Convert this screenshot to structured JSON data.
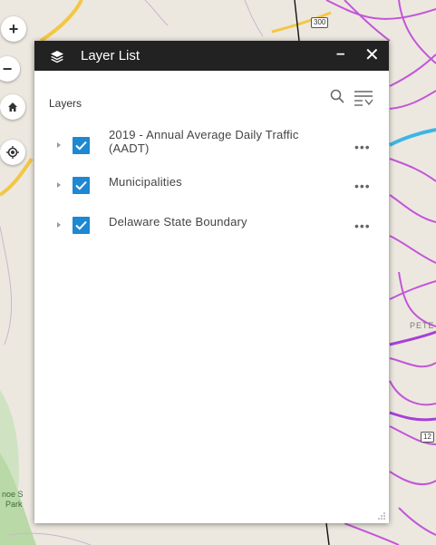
{
  "map": {
    "shield_300": "300",
    "shield_12": "12",
    "place_label": "PETE",
    "park_label_line1": "noe S",
    "park_label_line2": "Park"
  },
  "nav": {
    "zoom_in": "+",
    "zoom_out": "−",
    "home_icon": "home-icon",
    "locate_icon": "locate-icon"
  },
  "panel": {
    "title": "Layer List",
    "minimize": "–",
    "close": "✕",
    "layers_label": "Layers",
    "search_icon": "search-icon",
    "filter_icon": "filter-icon"
  },
  "layers": [
    {
      "name": "2019 - Annual Average Daily Traffic (AADT)",
      "checked": true,
      "more": "•••"
    },
    {
      "name": "Municipalities",
      "checked": true,
      "more": "•••"
    },
    {
      "name": "Delaware State Boundary",
      "checked": true,
      "more": "•••"
    }
  ],
  "colors": {
    "checkbox": "#1e88d2",
    "header": "#222222",
    "municipality_lines": "#c455d8",
    "road_yellow": "#f2c744",
    "highway_blue": "#3bb6e6"
  }
}
